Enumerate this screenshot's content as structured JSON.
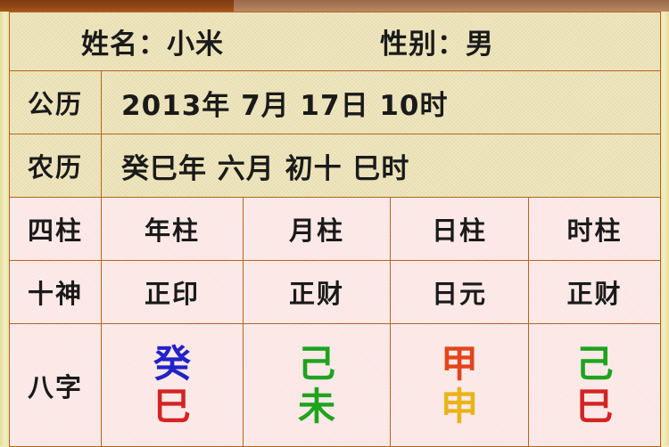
{
  "header": {
    "name_label": "姓名：小米",
    "gender_label": "性别：男"
  },
  "rows": {
    "solar": {
      "label": "公历",
      "value": "2013年 7月 17日 10时"
    },
    "lunar": {
      "label": "农历",
      "value": "癸巳年 六月 初十 巳时"
    },
    "pillars": {
      "label": "四柱",
      "year": "年柱",
      "month": "月柱",
      "day": "日柱",
      "hour": "时柱"
    },
    "ten_gods": {
      "label": "十神",
      "year": "正印",
      "month": "正财",
      "day": "日元",
      "hour": "正财"
    },
    "bazi": {
      "label": "八字",
      "year_stem": "癸",
      "year_branch": "巳",
      "month_stem": "己",
      "month_branch": "未",
      "day_stem": "甲",
      "day_branch": "申",
      "hour_stem": "己",
      "hour_branch": "巳"
    }
  },
  "colors": {
    "blue": "#2222c8",
    "red": "#d42323",
    "green": "#1fa31f",
    "orange": "#e2451c",
    "gold": "#e8b417",
    "border": "#b5651d",
    "tan_bg": "#ece3b8",
    "pink_bg": "#fbe6e4",
    "paper_bg": "#eee7ad",
    "topbar_left": "#8f4615",
    "topbar_right": "#a87a56"
  }
}
